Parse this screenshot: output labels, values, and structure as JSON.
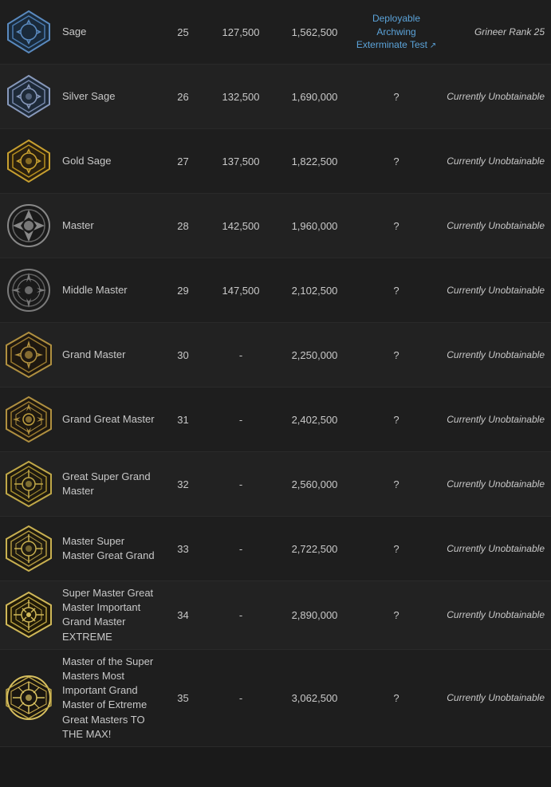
{
  "rows": [
    {
      "id": "sage",
      "name": "Sage",
      "rank": "25",
      "xp": "127,500",
      "total_xp": "1,562,500",
      "test_type": "link",
      "test_label": "Deployable Archwing Exterminate Test",
      "test_url": "#",
      "notes": "Grineer Rank 25",
      "notes_italic": true,
      "icon_type": "sage"
    },
    {
      "id": "silver-sage",
      "name": "Silver Sage",
      "rank": "26",
      "xp": "132,500",
      "total_xp": "1,690,000",
      "test_type": "question",
      "test_label": "?",
      "notes": "Currently Unobtainable",
      "icon_type": "silver-sage"
    },
    {
      "id": "gold-sage",
      "name": "Gold Sage",
      "rank": "27",
      "xp": "137,500",
      "total_xp": "1,822,500",
      "test_type": "question",
      "test_label": "?",
      "notes": "Currently Unobtainable",
      "icon_type": "gold-sage"
    },
    {
      "id": "master",
      "name": "Master",
      "rank": "28",
      "xp": "142,500",
      "total_xp": "1,960,000",
      "test_type": "question",
      "test_label": "?",
      "notes": "Currently Unobtainable",
      "icon_type": "master"
    },
    {
      "id": "middle-master",
      "name": "Middle Master",
      "rank": "29",
      "xp": "147,500",
      "total_xp": "2,102,500",
      "test_type": "question",
      "test_label": "?",
      "notes": "Currently Unobtainable",
      "icon_type": "middle-master"
    },
    {
      "id": "grand-master",
      "name": "Grand Master",
      "rank": "30",
      "xp": "-",
      "total_xp": "2,250,000",
      "test_type": "question",
      "test_label": "?",
      "notes": "Currently Unobtainable",
      "icon_type": "grand-master"
    },
    {
      "id": "grand-great-master",
      "name": "Grand Great Master",
      "rank": "31",
      "xp": "-",
      "total_xp": "2,402,500",
      "test_type": "question",
      "test_label": "?",
      "notes": "Currently Unobtainable",
      "icon_type": "grand-great-master"
    },
    {
      "id": "great-super-grand-master",
      "name": "Great Super Grand Master",
      "rank": "32",
      "xp": "-",
      "total_xp": "2,560,000",
      "test_type": "question",
      "test_label": "?",
      "notes": "Currently Unobtainable",
      "icon_type": "great-super-grand-master"
    },
    {
      "id": "master-super-master-great-grand",
      "name": "Master Super Master Great Grand",
      "rank": "33",
      "xp": "-",
      "total_xp": "2,722,500",
      "test_type": "question",
      "test_label": "?",
      "notes": "Currently Unobtainable",
      "icon_type": "master-super"
    },
    {
      "id": "super-master-great-master",
      "name": "Super Master Great Master Important Grand Master EXTREME",
      "rank": "34",
      "xp": "-",
      "total_xp": "2,890,000",
      "test_type": "question",
      "test_label": "?",
      "notes": "Currently Unobtainable",
      "icon_type": "super-master-extreme"
    },
    {
      "id": "master-of-super-masters",
      "name": "Master of the Super Masters Most Important Grand Master of Extreme Great Masters TO THE MAX!",
      "rank": "35",
      "xp": "-",
      "total_xp": "3,062,500",
      "test_type": "question",
      "test_label": "?",
      "notes": "Currently Unobtainable",
      "icon_type": "master-of-masters"
    }
  ]
}
